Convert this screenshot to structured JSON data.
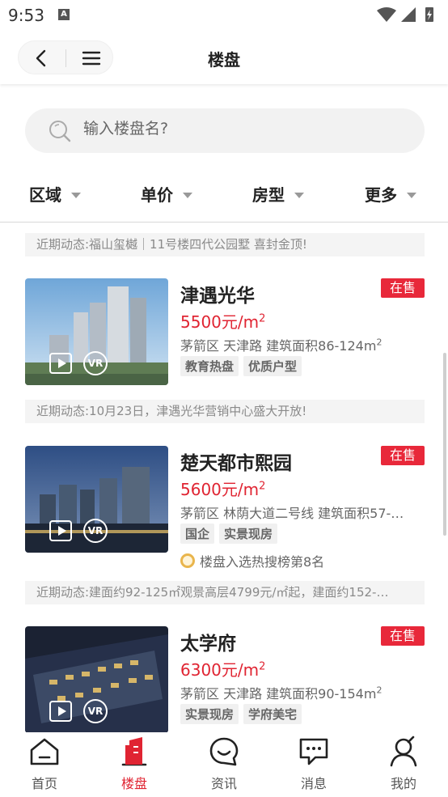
{
  "status_bar": {
    "time": "9:53",
    "notification_letter": "A"
  },
  "nav": {
    "title": "楼盘"
  },
  "search": {
    "placeholder": "输入楼盘名?"
  },
  "filters": [
    {
      "label": "区域"
    },
    {
      "label": "单价"
    },
    {
      "label": "房型"
    },
    {
      "label": "更多"
    }
  ],
  "listings": [
    {
      "news": "近期动态:福山玺樾｜11号楼四代公园墅 喜封金顶!",
      "name": "津遇光华",
      "price": "5500元/m",
      "price_unit_sup": "2",
      "meta": "茅箭区 天津路 建筑面积86-124m",
      "meta_sup": "2",
      "tags": [
        "教育热盘",
        "优质户型"
      ],
      "status": "在售",
      "vr_label": "VR"
    },
    {
      "news": "近期动态:10月23日，津遇光华营销中心盛大开放!",
      "name": "楚天都市熙园",
      "price": "5600元/m",
      "price_unit_sup": "2",
      "meta": "茅箭区 林荫大道二号线 建筑面积57-…",
      "meta_sup": "",
      "tags": [
        "国企",
        "实景现房"
      ],
      "status": "在售",
      "rank": "楼盘入选热搜榜第8名",
      "vr_label": "VR"
    },
    {
      "news": "近期动态:建面约92-125㎡观景高层4799元/㎡起，建面约152-…",
      "name": "太学府",
      "price": "6300元/m",
      "price_unit_sup": "2",
      "meta": "茅箭区 天津路 建筑面积90-154m",
      "meta_sup": "2",
      "tags": [
        "实景现房",
        "学府美宅"
      ],
      "status": "在售",
      "vr_label": "VR"
    }
  ],
  "tabs": [
    {
      "label": "首页",
      "icon": "home-icon"
    },
    {
      "label": "楼盘",
      "icon": "building-icon",
      "active": true
    },
    {
      "label": "资讯",
      "icon": "news-icon"
    },
    {
      "label": "消息",
      "icon": "message-icon"
    },
    {
      "label": "我的",
      "icon": "profile-icon"
    }
  ],
  "colors": {
    "accent": "#e02432",
    "badge": "#e8283a"
  }
}
